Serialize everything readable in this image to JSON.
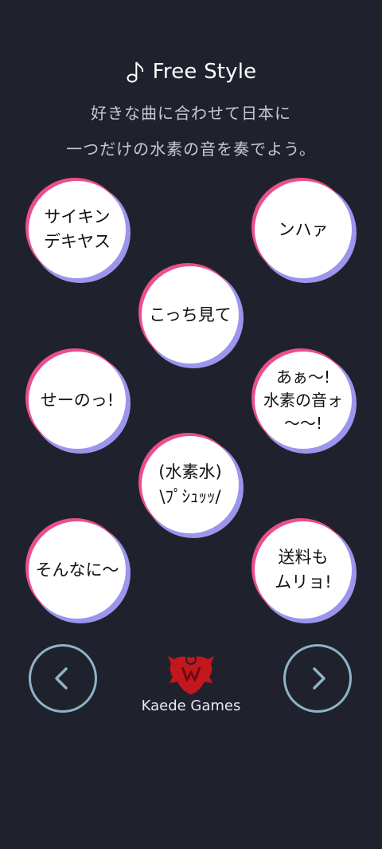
{
  "header": {
    "title": "Free Style",
    "icon": "music-note-icon",
    "subtitle_line1": "好きな曲に合わせて日本に",
    "subtitle_line2": "一つだけの水素の音を奏でよう。"
  },
  "sound_buttons": [
    {
      "label": "サイキン\nデキヤス"
    },
    {
      "label": "ンハァ"
    },
    {
      "label": "こっち見て"
    },
    {
      "label": "せーのっ!"
    },
    {
      "label": "あぁ〜!\n水素の音ォ\n〜〜!"
    },
    {
      "label": "(水素水)\n\\ﾌﾟｼｭｯｯ/"
    },
    {
      "label": "そんなに〜"
    },
    {
      "label": "送料も\nムリョ!"
    }
  ],
  "nav": {
    "prev_icon": "chevron-left-icon",
    "next_icon": "chevron-right-icon"
  },
  "footer": {
    "brand": "Kaede Games",
    "logo_icon": "kaede-games-logo-icon"
  },
  "colors": {
    "background": "#1f222d",
    "circle_pink": "#ea4f8e",
    "circle_purple": "#9c95ec",
    "nav_ring": "#8fb3c6",
    "logo_red": "#c4171d"
  }
}
